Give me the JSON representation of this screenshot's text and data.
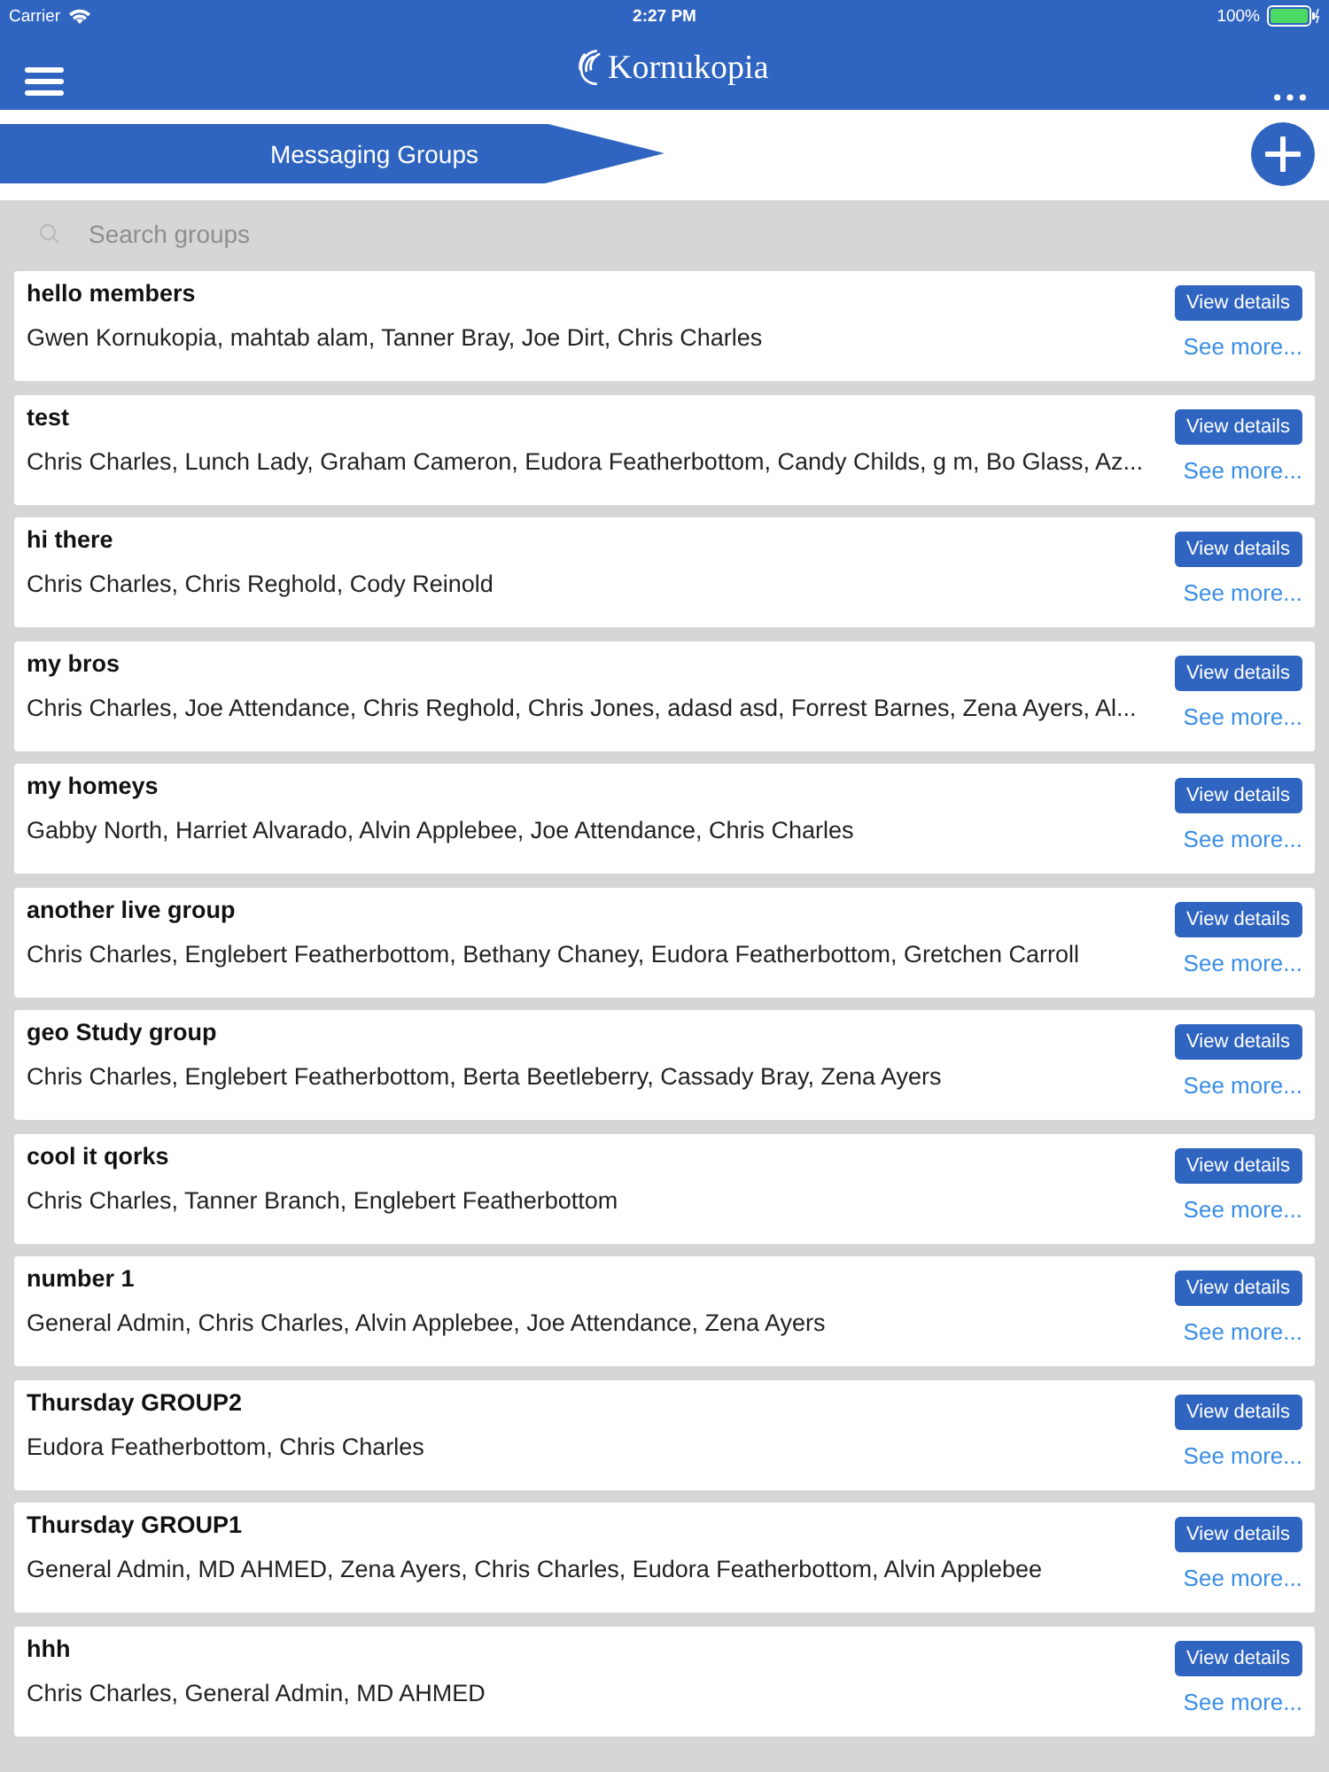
{
  "status_bar": {
    "carrier": "Carrier",
    "time": "2:27 PM",
    "battery": "100%"
  },
  "nav_bar": {
    "logo_text": "Kornukopia"
  },
  "header": {
    "title": "Messaging Groups"
  },
  "search": {
    "placeholder": "Search groups"
  },
  "groups": [
    {
      "name": "hello members",
      "members": "Gwen Kornukopia, mahtab alam, Tanner Bray, Joe Dirt, Chris Charles",
      "button": "View details",
      "link": "See more..."
    },
    {
      "name": "test",
      "members": "Chris Charles, Lunch Lady, Graham Cameron, Eudora Featherbottom, Candy Childs, g m, Bo Glass, Az...",
      "button": "View details",
      "link": "See more..."
    },
    {
      "name": "hi there",
      "members": "Chris Charles, Chris Reghold, Cody Reinold",
      "button": "View details",
      "link": "See more..."
    },
    {
      "name": "my bros",
      "members": "Chris Charles, Joe  Attendance, Chris Reghold, Chris Jones, adasd asd, Forrest Barnes, Zena Ayers, Al...",
      "button": "View details",
      "link": "See more..."
    },
    {
      "name": "my homeys",
      "members": "Gabby North, Harriet Alvarado, Alvin Applebee, Joe  Attendance, Chris Charles",
      "button": "View details",
      "link": "See more..."
    },
    {
      "name": "another live group",
      "members": "Chris Charles, Englebert Featherbottom, Bethany Chaney, Eudora Featherbottom, Gretchen Carroll",
      "button": "View details",
      "link": "See more..."
    },
    {
      "name": "geo Study group",
      "members": "Chris Charles, Englebert Featherbottom, Berta Beetleberry, Cassady Bray, Zena Ayers",
      "button": "View details",
      "link": "See more..."
    },
    {
      "name": "cool it qorks",
      "members": "Chris Charles, Tanner Branch, Englebert Featherbottom",
      "button": "View details",
      "link": "See more..."
    },
    {
      "name": "number 1",
      "members": "General Admin, Chris Charles, Alvin Applebee, Joe  Attendance, Zena Ayers",
      "button": "View details",
      "link": "See more..."
    },
    {
      "name": "Thursday GROUP2",
      "members": "Eudora Featherbottom, Chris Charles",
      "button": "View details",
      "link": "See more..."
    },
    {
      "name": "Thursday GROUP1",
      "members": "General Admin, MD AHMED, Zena Ayers, Chris Charles, Eudora Featherbottom, Alvin Applebee",
      "button": "View details",
      "link": "See more..."
    },
    {
      "name": "hhh",
      "members": "Chris Charles, General Admin, MD AHMED",
      "button": "View details",
      "link": "See more..."
    }
  ]
}
